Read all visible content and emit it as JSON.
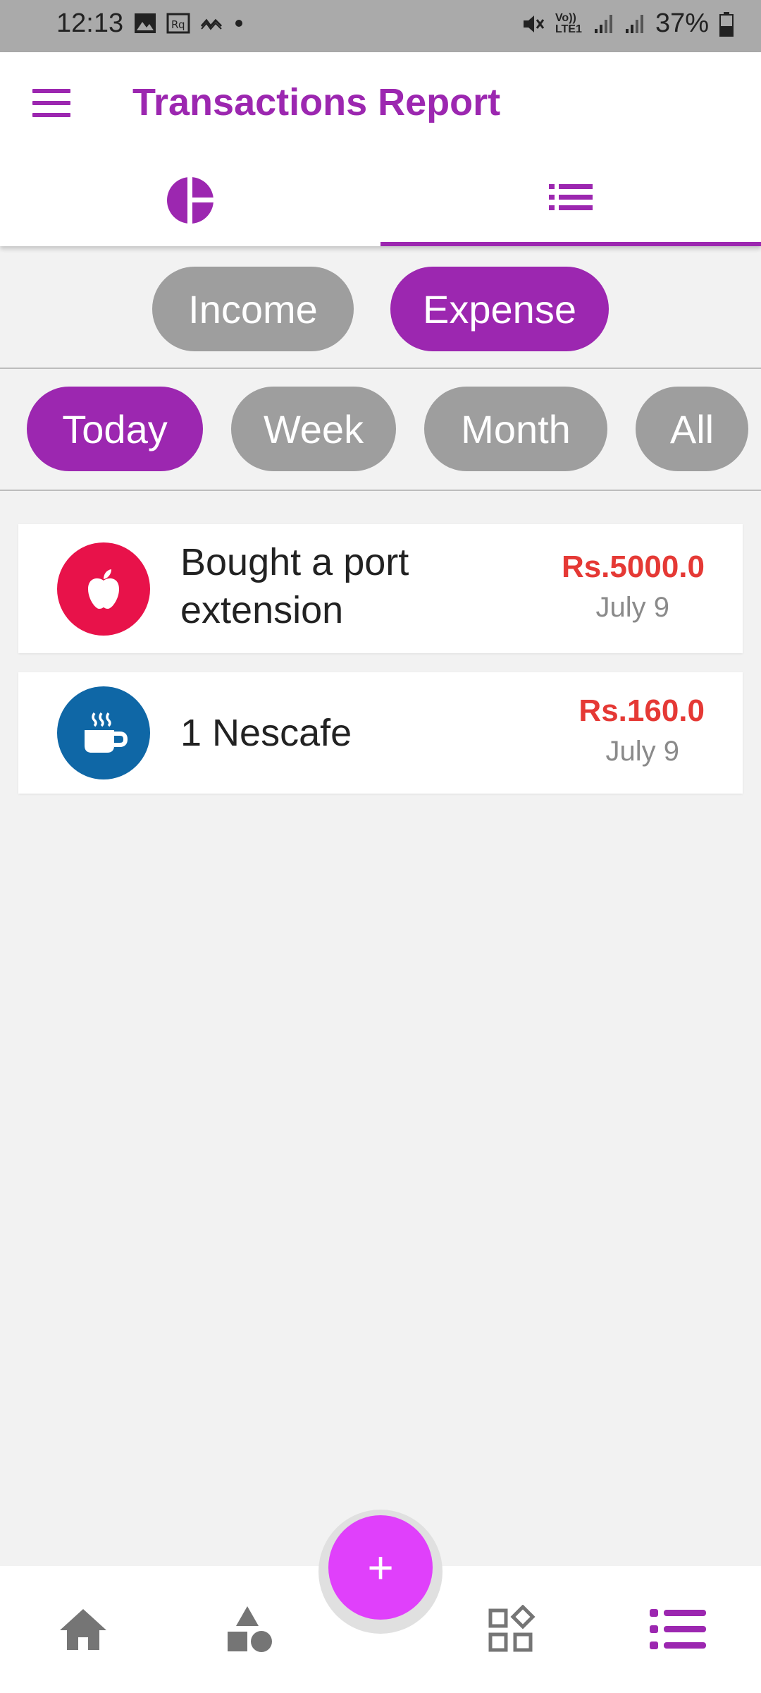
{
  "status_bar": {
    "time": "12:13",
    "network": "Vo)) LTE1",
    "battery": "37%"
  },
  "appbar": {
    "title": "Transactions Report"
  },
  "tabs": [
    {
      "name": "chart",
      "icon": "pie-chart-icon",
      "selected": false
    },
    {
      "name": "list",
      "icon": "list-icon",
      "selected": true
    }
  ],
  "type_filter": {
    "income": "Income",
    "expense": "Expense",
    "selected": "Expense"
  },
  "period_filter": {
    "today": "Today",
    "week": "Week",
    "month": "Month",
    "all": "All",
    "selected": "Today"
  },
  "transactions": [
    {
      "title_line1": "Bought a port",
      "title_line2": "extension",
      "amount": "Rs.5000.0",
      "date": "July 9",
      "icon": "apple-icon",
      "icon_color": "#e8124a"
    },
    {
      "title": "1 Nescafe",
      "amount": "Rs.160.0",
      "date": "July 9",
      "icon": "coffee-icon",
      "icon_color": "#0f67a6"
    }
  ],
  "fab": {
    "label": "+"
  },
  "bottom_nav": [
    {
      "icon": "home-icon"
    },
    {
      "icon": "shapes-icon"
    },
    {
      "icon": "widgets-icon"
    },
    {
      "icon": "list-icon",
      "selected": true
    }
  ],
  "colors": {
    "accent": "#9c27b0",
    "fab": "#e040fb",
    "amount": "#e53935",
    "chip_inactive": "#9e9e9e"
  }
}
